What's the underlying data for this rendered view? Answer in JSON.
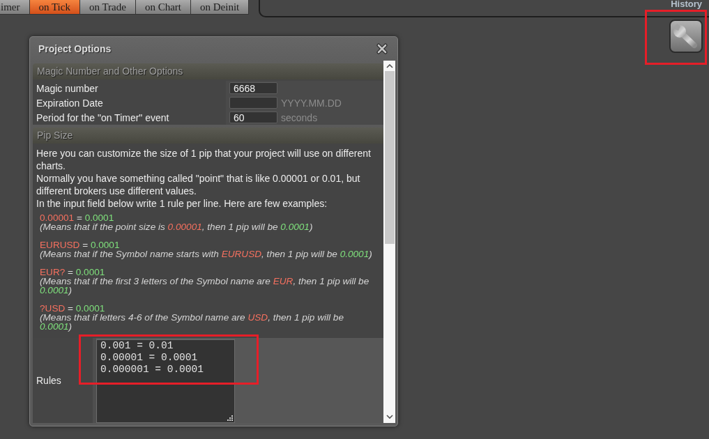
{
  "tabs": [
    {
      "label": "imer",
      "selected": false
    },
    {
      "label": "on Tick",
      "selected": true
    },
    {
      "label": "on Trade",
      "selected": false
    },
    {
      "label": "on Chart",
      "selected": false
    },
    {
      "label": "on Deinit",
      "selected": false
    }
  ],
  "panel": {
    "title": "History"
  },
  "dialog": {
    "title": "Project Options",
    "options": {
      "title": "Magic Number and Other Options",
      "rows": [
        {
          "label": "Magic number",
          "value": "6668"
        },
        {
          "label": "Expiration Date",
          "note": "YYYY.MM.DD"
        },
        {
          "label": "Period for the \"on Timer\" event",
          "value": "60",
          "note": "seconds"
        }
      ]
    },
    "pip_size": {
      "title": "Pip Size",
      "paragraphs": [
        "Here you can customize the size of 1 pip that your project will use on different charts.",
        "Normally you have something called \"point\" that is like 0.00001 or 0.01, but different brokers use different values.",
        "In the input field below write 1 rule per line. Here are few examples:"
      ],
      "examples": [
        {
          "rule": [
            {
              "kind": "pattern",
              "text": "0.00001"
            },
            {
              "kind": "plain",
              "text": " = "
            },
            {
              "kind": "pip",
              "text": "0.0001"
            }
          ],
          "explanation": [
            {
              "kind": "plain",
              "text": "(Means that if the point size is "
            },
            {
              "kind": "pattern",
              "text": "0.00001"
            },
            {
              "kind": "plain",
              "text": ", then 1 pip will be "
            },
            {
              "kind": "pip",
              "text": "0.0001"
            },
            {
              "kind": "plain",
              "text": ")"
            }
          ]
        },
        {
          "rule": [
            {
              "kind": "pattern",
              "text": "EURUSD"
            },
            {
              "kind": "plain",
              "text": " = "
            },
            {
              "kind": "pip",
              "text": "0.0001"
            }
          ],
          "explanation": [
            {
              "kind": "plain",
              "text": "(Means that if the Symbol name starts with "
            },
            {
              "kind": "pattern",
              "text": "EURUSD"
            },
            {
              "kind": "plain",
              "text": ", then 1 pip will be "
            },
            {
              "kind": "pip",
              "text": "0.0001"
            },
            {
              "kind": "plain",
              "text": ")"
            }
          ]
        },
        {
          "rule": [
            {
              "kind": "pattern",
              "text": "EUR?"
            },
            {
              "kind": "plain",
              "text": " = "
            },
            {
              "kind": "pip",
              "text": "0.0001"
            }
          ],
          "explanation": [
            {
              "kind": "plain",
              "text": "(Means that if the first 3 letters of the Symbol name are "
            },
            {
              "kind": "pattern",
              "text": "EUR"
            },
            {
              "kind": "plain",
              "text": ", then 1 pip will be "
            },
            {
              "kind": "pip",
              "text": "0.0001"
            },
            {
              "kind": "plain",
              "text": ")"
            }
          ]
        },
        {
          "rule": [
            {
              "kind": "pattern",
              "text": "?USD"
            },
            {
              "kind": "plain",
              "text": " = "
            },
            {
              "kind": "pip",
              "text": "0.0001"
            }
          ],
          "explanation": [
            {
              "kind": "plain",
              "text": "(Means that if letters 4-6 of the Symbol name are "
            },
            {
              "kind": "pattern",
              "text": "USD"
            },
            {
              "kind": "plain",
              "text": ", then 1 pip will be "
            },
            {
              "kind": "pip",
              "text": "0.0001"
            },
            {
              "kind": "plain",
              "text": ")"
            }
          ]
        }
      ],
      "rules": {
        "label": "Rules",
        "lines": [
          "0.001 = 0.01",
          "0.00001 = 0.0001",
          "0.000001 = 0.0001"
        ]
      }
    }
  }
}
